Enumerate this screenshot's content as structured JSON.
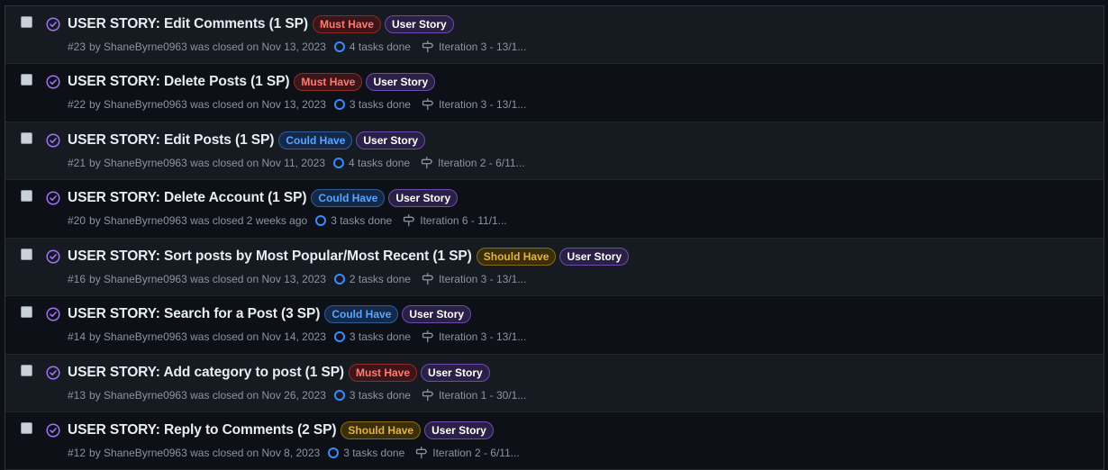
{
  "issues": [
    {
      "title": "USER STORY: Edit Comments (1 SP)",
      "labels": [
        {
          "text": "Must Have",
          "kind": "must"
        },
        {
          "text": "User Story",
          "kind": "story"
        }
      ],
      "number": "#23",
      "meta": "by ShaneByrne0963 was closed on Nov 13, 2023",
      "tasks": "4 tasks done",
      "milestone": "Iteration 3 - 13/1..."
    },
    {
      "title": "USER STORY: Delete Posts (1 SP)",
      "labels": [
        {
          "text": "Must Have",
          "kind": "must"
        },
        {
          "text": "User Story",
          "kind": "story"
        }
      ],
      "number": "#22",
      "meta": "by ShaneByrne0963 was closed on Nov 13, 2023",
      "tasks": "3 tasks done",
      "milestone": "Iteration 3 - 13/1..."
    },
    {
      "title": "USER STORY: Edit Posts (1 SP)",
      "labels": [
        {
          "text": "Could Have",
          "kind": "could"
        },
        {
          "text": "User Story",
          "kind": "story"
        }
      ],
      "number": "#21",
      "meta": "by ShaneByrne0963 was closed on Nov 11, 2023",
      "tasks": "4 tasks done",
      "milestone": "Iteration 2 - 6/11..."
    },
    {
      "title": "USER STORY: Delete Account (1 SP)",
      "labels": [
        {
          "text": "Could Have",
          "kind": "could"
        },
        {
          "text": "User Story",
          "kind": "story"
        }
      ],
      "number": "#20",
      "meta": "by ShaneByrne0963 was closed 2 weeks ago",
      "tasks": "3 tasks done",
      "milestone": "Iteration 6 - 11/1..."
    },
    {
      "title": "USER STORY: Sort posts by Most Popular/Most Recent (1 SP)",
      "labels": [
        {
          "text": "Should Have",
          "kind": "should"
        },
        {
          "text": "User Story",
          "kind": "story"
        }
      ],
      "number": "#16",
      "meta": "by ShaneByrne0963 was closed on Nov 13, 2023",
      "tasks": "2 tasks done",
      "milestone": "Iteration 3 - 13/1..."
    },
    {
      "title": "USER STORY: Search for a Post (3 SP)",
      "labels": [
        {
          "text": "Could Have",
          "kind": "could"
        },
        {
          "text": "User Story",
          "kind": "story"
        }
      ],
      "number": "#14",
      "meta": "by ShaneByrne0963 was closed on Nov 14, 2023",
      "tasks": "3 tasks done",
      "milestone": "Iteration 3 - 13/1..."
    },
    {
      "title": "USER STORY: Add category to post (1 SP)",
      "labels": [
        {
          "text": "Must Have",
          "kind": "must"
        },
        {
          "text": "User Story",
          "kind": "story"
        }
      ],
      "number": "#13",
      "meta": "by ShaneByrne0963 was closed on Nov 26, 2023",
      "tasks": "3 tasks done",
      "milestone": "Iteration 1 - 30/1..."
    },
    {
      "title": "USER STORY: Reply to Comments (2 SP)",
      "labels": [
        {
          "text": "Should Have",
          "kind": "should"
        },
        {
          "text": "User Story",
          "kind": "story"
        }
      ],
      "number": "#12",
      "meta": "by ShaneByrne0963 was closed on Nov 8, 2023",
      "tasks": "3 tasks done",
      "milestone": "Iteration 2 - 6/11..."
    }
  ],
  "colors": {
    "background": "#0d1117",
    "closed_icon": "#a371f7",
    "task_ring": "#388bfd"
  },
  "icons": {
    "state": "issue-closed-icon",
    "milestone": "milestone-icon"
  }
}
